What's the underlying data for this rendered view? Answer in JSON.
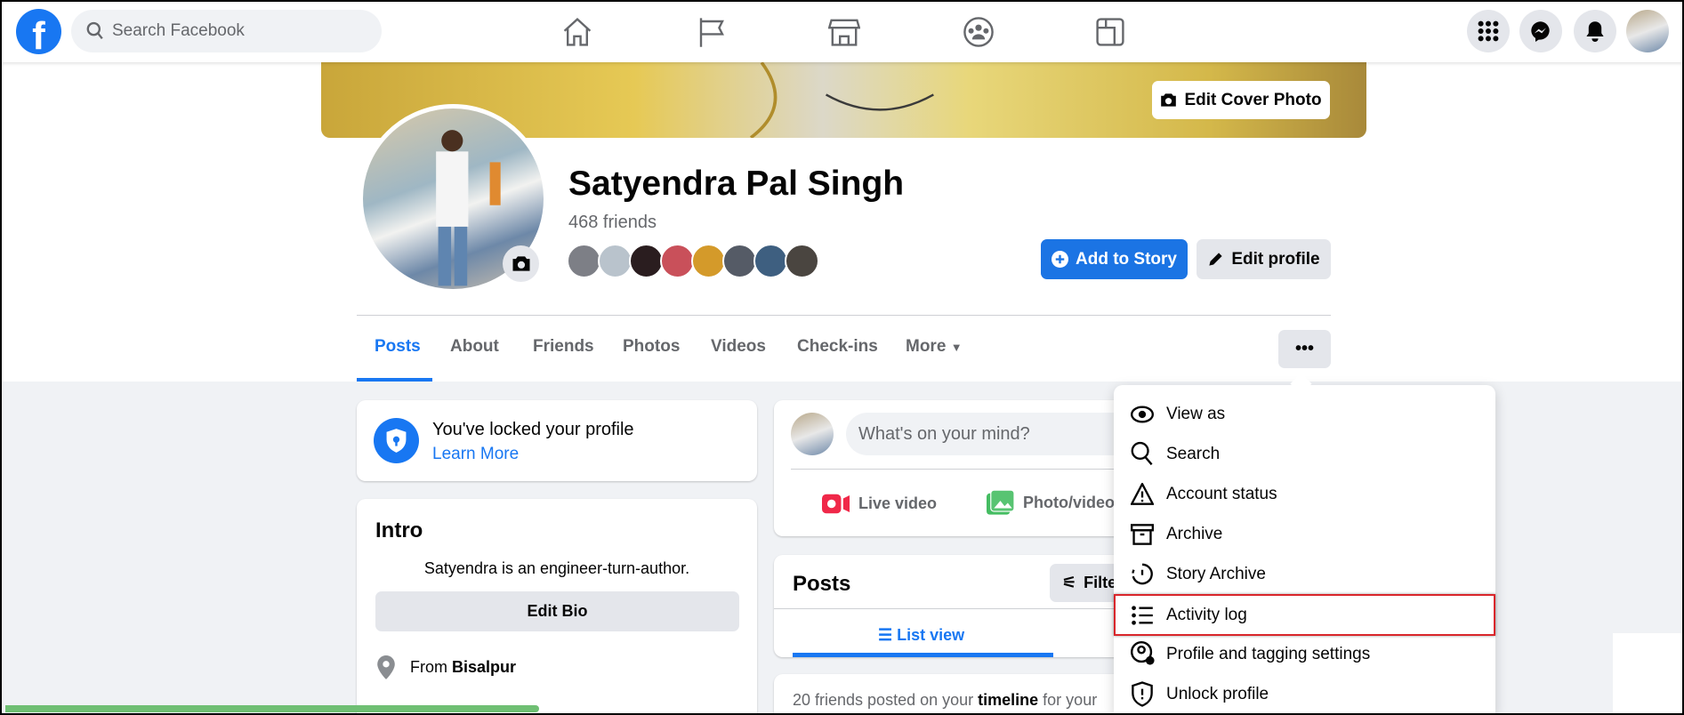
{
  "topnav": {
    "search_placeholder": "Search Facebook",
    "nav_icons": [
      "home-icon",
      "pages-flag-icon",
      "marketplace-icon",
      "groups-icon",
      "gaming-icon"
    ],
    "right_icons": [
      "menu-grid-icon",
      "messenger-icon",
      "notifications-bell-icon",
      "account-avatar"
    ]
  },
  "profile": {
    "edit_cover": "Edit Cover Photo",
    "name": "Satyendra Pal Singh",
    "friends": "468 friends",
    "add_story": "Add to Story",
    "edit_profile": "Edit profile"
  },
  "tabs": [
    {
      "label": "Posts",
      "active": true
    },
    {
      "label": "About"
    },
    {
      "label": "Friends"
    },
    {
      "label": "Photos"
    },
    {
      "label": "Videos"
    },
    {
      "label": "Check-ins"
    },
    {
      "label": "More"
    }
  ],
  "lock": {
    "title": "You've locked your profile",
    "link": "Learn More"
  },
  "intro": {
    "title": "Intro",
    "bio": "Satyendra is an engineer-turn-author.",
    "edit_bio": "Edit Bio",
    "from_label": "From ",
    "from_value": "Bisalpur"
  },
  "composer": {
    "placeholder": "What's on your mind?",
    "live": "Live video",
    "photo": "Photo/video"
  },
  "posts": {
    "title": "Posts",
    "filter": "Filters",
    "list_view": "List view"
  },
  "timeline": {
    "prefix": "20 friends posted on your ",
    "bold": "timeline",
    "suffix": " for your"
  },
  "menu": {
    "items": [
      "View as",
      "Search",
      "Account status",
      "Archive",
      "Story Archive",
      "Activity log",
      "Profile and tagging settings",
      "Unlock profile"
    ],
    "highlighted": "Activity log"
  },
  "colors": {
    "brand": "#1877f2",
    "highlight": "#d9262b"
  }
}
